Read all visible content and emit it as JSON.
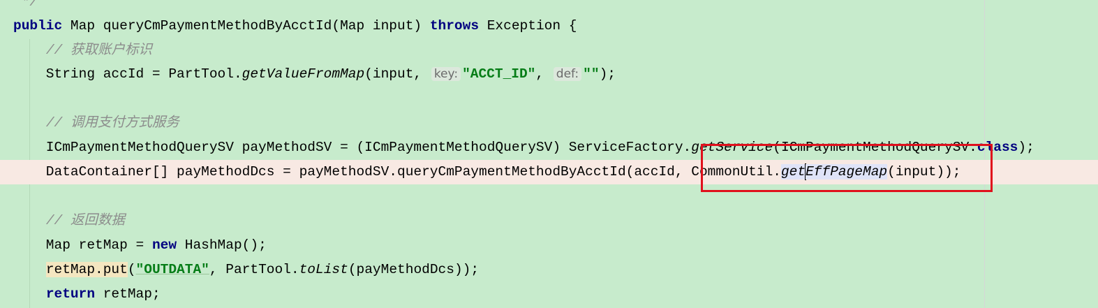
{
  "editor": {
    "lines": [
      {
        "y": 0,
        "tokens": [
          {
            "t": " */",
            "c": "cm"
          }
        ]
      },
      {
        "tokens": [
          {
            "t": "public",
            "c": "kw"
          },
          {
            "t": " Map queryCmPaymentMethodByAcctId(Map input) "
          },
          {
            "t": "throws",
            "c": "kw"
          },
          {
            "t": " Exception {"
          }
        ]
      },
      {
        "tokens": [
          {
            "t": "    "
          },
          {
            "t": "// 获取账户标识",
            "c": "cm"
          }
        ]
      },
      {
        "tokens": [
          {
            "t": "    String accId = PartTool."
          },
          {
            "t": "getValueFromMap",
            "c": "it"
          },
          {
            "t": "(input, "
          },
          {
            "t": "key:",
            "c": "hint"
          },
          {
            "t": "\"ACCT_ID\"",
            "c": "str"
          },
          {
            "t": ", "
          },
          {
            "t": "def:",
            "c": "hint"
          },
          {
            "t": "\"\"",
            "c": "str"
          },
          {
            "t": ");"
          }
        ]
      },
      {
        "tokens": []
      },
      {
        "tokens": [
          {
            "t": "    "
          },
          {
            "t": "// 调用支付方式服务",
            "c": "cm"
          }
        ]
      },
      {
        "tokens": [
          {
            "t": "    ICmPaymentMethodQuerySV payMethodSV = (ICmPaymentMethodQuerySV) ServiceFactory."
          },
          {
            "t": "getService",
            "c": "it"
          },
          {
            "t": "(ICmPaymentMethodQuerySV."
          },
          {
            "t": "class",
            "c": "kw"
          },
          {
            "t": ");"
          }
        ]
      },
      {
        "highlight": true,
        "tokens": [
          {
            "t": "    DataContainer[] payMethodDcs = payMethodSV.queryCmPaymentMethodByAcctId(accId, CommonUtil."
          },
          {
            "t": "get",
            "c": "it sel"
          },
          {
            "t": "",
            "c": "caret"
          },
          {
            "t": "EffPageMap",
            "c": "it sel"
          },
          {
            "t": "(input));"
          }
        ]
      },
      {
        "tokens": []
      },
      {
        "tokens": [
          {
            "t": "    "
          },
          {
            "t": "// 返回数据",
            "c": "cm"
          }
        ]
      },
      {
        "tokens": [
          {
            "t": "    Map retMap = "
          },
          {
            "t": "new",
            "c": "kw"
          },
          {
            "t": " HashMap();"
          }
        ]
      },
      {
        "tokens": [
          {
            "t": "    "
          },
          {
            "t": "retMap.put",
            "c": "warn"
          },
          {
            "t": "("
          },
          {
            "t": "\"OUTDATA\"",
            "c": "str under"
          },
          {
            "t": ", PartTool."
          },
          {
            "t": "toList",
            "c": "it"
          },
          {
            "t": "(payMethodDcs));"
          }
        ]
      },
      {
        "tokens": [
          {
            "t": "    "
          },
          {
            "t": "return",
            "c": "kw"
          },
          {
            "t": " retMap;"
          }
        ]
      }
    ]
  }
}
